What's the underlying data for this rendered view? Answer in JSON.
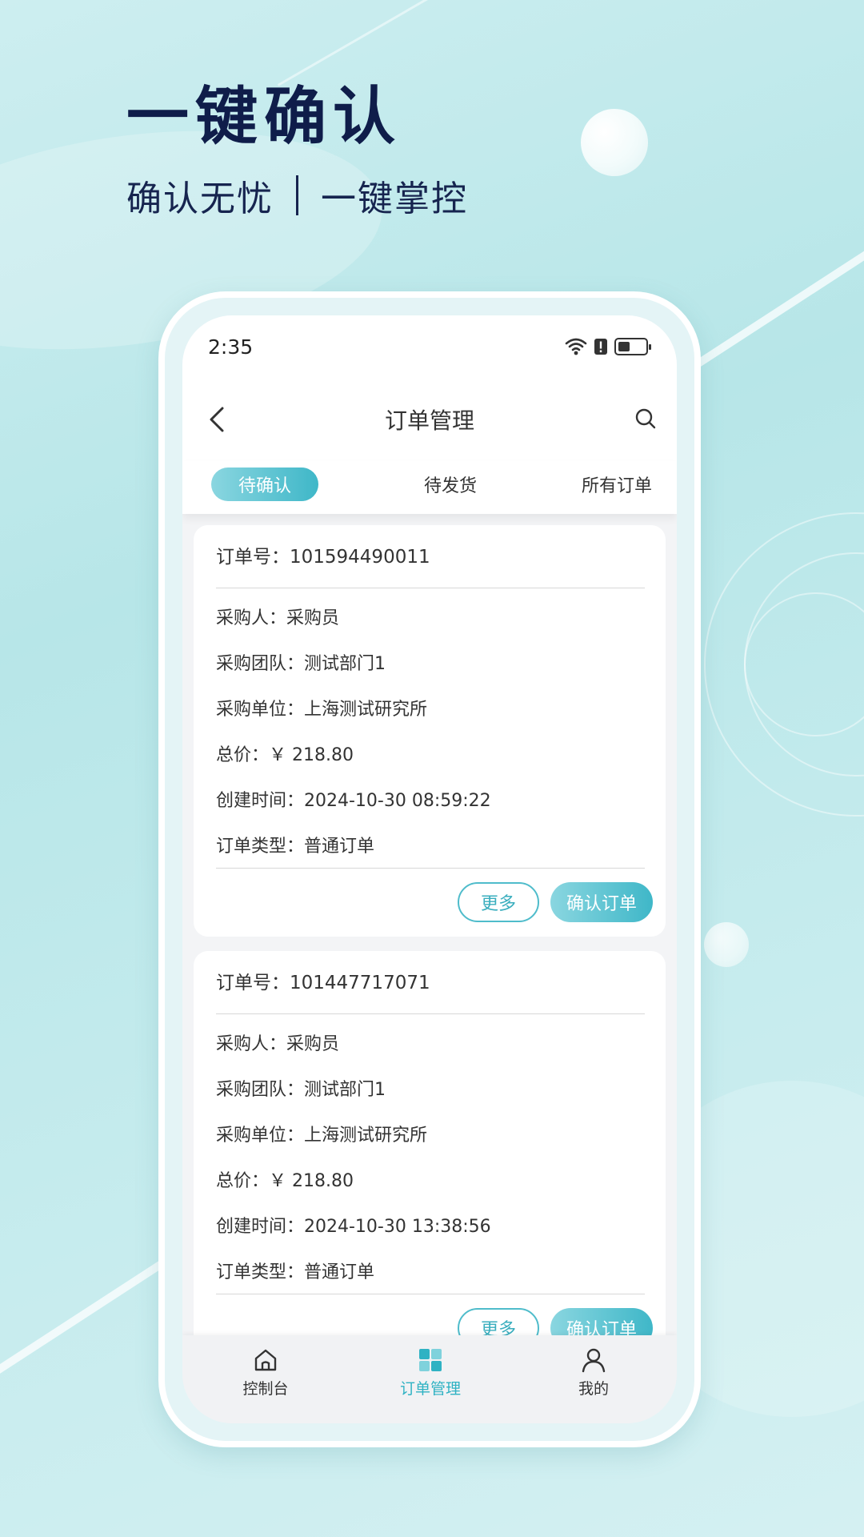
{
  "hero": {
    "title": "一键确认",
    "subtitle_left": "确认无忧",
    "subtitle_right": "一键掌控"
  },
  "status_bar": {
    "time": "2:35",
    "icons": [
      "wifi-icon",
      "alert-icon",
      "battery-icon"
    ],
    "battery_level": 0.4
  },
  "nav": {
    "title": "订单管理",
    "back_icon": "chevron-left-icon",
    "search_icon": "search-icon"
  },
  "tabs": [
    {
      "label": "待确认",
      "active": true
    },
    {
      "label": "待发货",
      "active": false
    },
    {
      "label": "所有订单",
      "active": false
    }
  ],
  "orders": [
    {
      "order_no": "订单号：101594490011",
      "buyer": "采购人：采购员",
      "team": "采购团队：测试部门1",
      "unit": "采购单位：上海测试研究所",
      "total": "总价：￥ 218.80",
      "created": "创建时间：2024-10-30 08:59:22",
      "type": "订单类型：普通订单",
      "more_label": "更多",
      "confirm_label": "确认订单"
    },
    {
      "order_no": "订单号：101447717071",
      "buyer": "采购人：采购员",
      "team": "采购团队：测试部门1",
      "unit": "采购单位：上海测试研究所",
      "total": "总价：￥ 218.80",
      "created": "创建时间：2024-10-30 13:38:56",
      "type": "订单类型：普通订单",
      "more_label": "更多",
      "confirm_label": "确认订单"
    }
  ],
  "tabbar": [
    {
      "label": "控制台",
      "icon": "home-icon",
      "active": false
    },
    {
      "label": "订单管理",
      "icon": "grid-icon",
      "active": true
    },
    {
      "label": "我的",
      "icon": "user-icon",
      "active": false
    }
  ],
  "colors": {
    "accent": "#3fb7c8",
    "accent_light": "#8ad6e0",
    "hero_text": "#0f1d4a",
    "background": "#bfe8ea"
  }
}
